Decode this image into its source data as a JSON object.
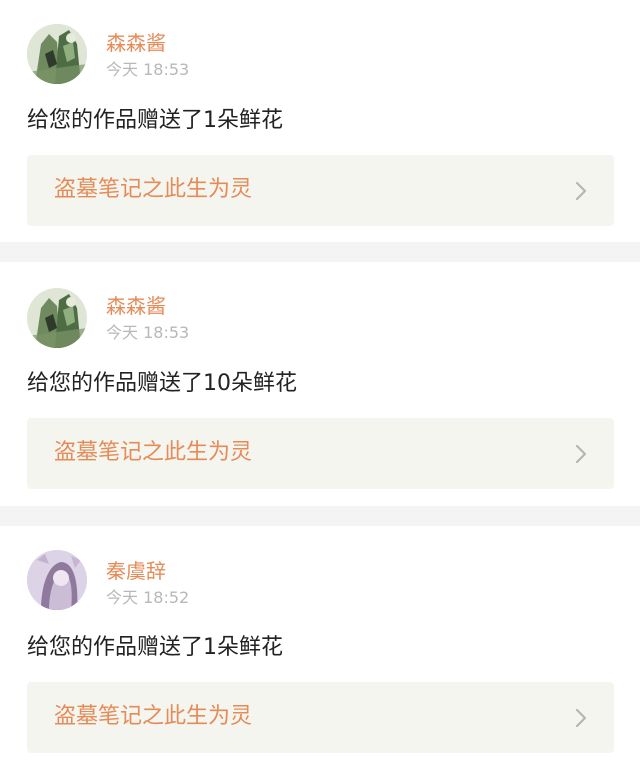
{
  "notifications": [
    {
      "username": "森森酱",
      "time": "今天 18:53",
      "message": "给您的作品赠送了1朵鲜花",
      "work_title": "盗墓笔记之此生为灵",
      "avatar": "avatar-green-illustration"
    },
    {
      "username": "森森酱",
      "time": "今天 18:53",
      "message": "给您的作品赠送了10朵鲜花",
      "work_title": "盗墓笔记之此生为灵",
      "avatar": "avatar-green-illustration"
    },
    {
      "username": "秦虞辞",
      "time": "今天 18:52",
      "message": "给您的作品赠送了1朵鲜花",
      "work_title": "盗墓笔记之此生为灵",
      "avatar": "avatar-purple-illustration"
    }
  ],
  "colors": {
    "accent": "#e58b57",
    "muted": "#b8b8b8",
    "text": "#222222",
    "link_bg": "#f5f5f0",
    "divider": "#f4f4f4"
  },
  "icons": {
    "link_arrow": "chevron-right-icon"
  }
}
